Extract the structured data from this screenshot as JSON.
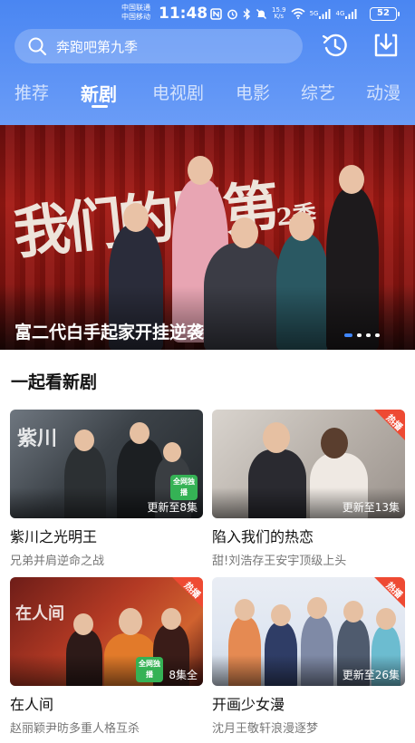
{
  "status_bar": {
    "carrier_top": "中国联通",
    "carrier_bottom": "中国移动",
    "time": "11:48",
    "net_speed_value": "15.9",
    "net_speed_unit": "K/s",
    "signal_1": "5G",
    "signal_2": "4G",
    "battery": "52"
  },
  "header": {
    "search_placeholder": "奔跑吧第九季",
    "history_icon": "history-icon",
    "download_icon": "download-icon",
    "background_color": "#5b92f5"
  },
  "tabs": [
    {
      "label": "推荐",
      "active": false
    },
    {
      "label": "新剧",
      "active": true
    },
    {
      "label": "电视剧",
      "active": false
    },
    {
      "label": "电影",
      "active": false
    },
    {
      "label": "综艺",
      "active": false
    },
    {
      "label": "动漫",
      "active": false
    }
  ],
  "banner": {
    "title": "富二代白手起家开挂逆袭",
    "art_text": "我们的甲第",
    "art_subtext": "2季",
    "slides_total": 4,
    "active_slide": 1,
    "accent_color": "#3f86ff"
  },
  "section": {
    "title": "一起看新剧"
  },
  "cards": [
    {
      "title": "紫川之光明王",
      "subtitle": "兄弟并肩逆命之战",
      "episode": "更新至8集",
      "badge_text": "全网独播",
      "watermark": "紫川"
    },
    {
      "title": "陷入我们的热恋",
      "subtitle": "甜!刘浩存王安宇顶级上头",
      "episode": "更新至13集",
      "hot": "热播"
    },
    {
      "title": "在人间",
      "subtitle": "赵丽颖尹昉多重人格互杀",
      "episode": "8集全",
      "hot": "热播",
      "badge_text": "全网独播",
      "watermark": "在人间"
    },
    {
      "title": "开画少女漫",
      "subtitle": "沈月王敬轩浪漫逐梦",
      "episode": "更新至26集",
      "hot": "热播"
    }
  ]
}
